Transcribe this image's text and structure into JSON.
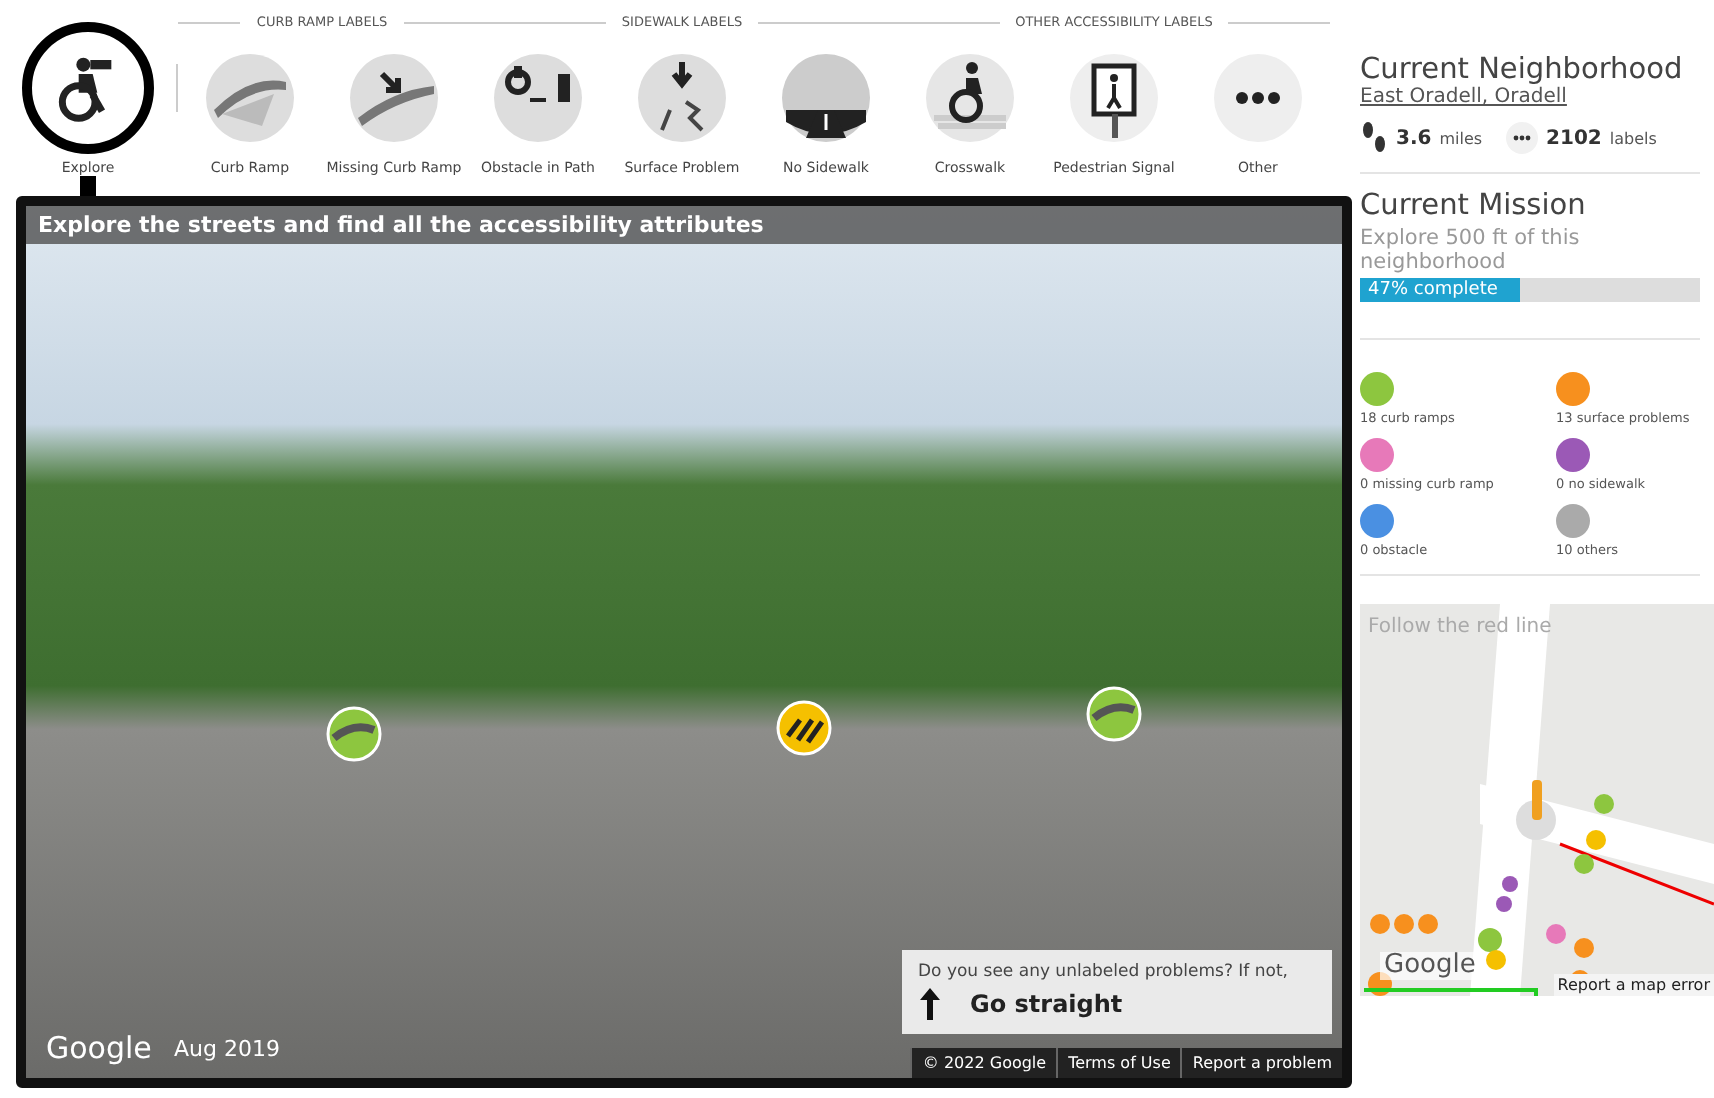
{
  "toolbar": {
    "explore": {
      "label": "Explore",
      "kind": "explore",
      "selected": true
    },
    "groups": [
      {
        "heading": "CURB RAMP LABELS",
        "tools": [
          {
            "label": "Curb Ramp",
            "kind": "curb_ramp",
            "selected": false
          },
          {
            "label": "Missing Curb Ramp",
            "kind": "missing_curb_ramp",
            "selected": false
          }
        ]
      },
      {
        "heading": "SIDEWALK LABELS",
        "tools": [
          {
            "label": "Obstacle in Path",
            "kind": "obstacle",
            "selected": false
          },
          {
            "label": "Surface Problem",
            "kind": "surface_problem",
            "selected": false
          },
          {
            "label": "No Sidewalk",
            "kind": "no_sidewalk",
            "selected": false
          }
        ]
      },
      {
        "heading": "OTHER ACCESSIBILITY LABELS",
        "tools": [
          {
            "label": "Crosswalk",
            "kind": "crosswalk",
            "selected": false
          },
          {
            "label": "Pedestrian Signal",
            "kind": "pedestrian_signal",
            "selected": false
          },
          {
            "label": "Other",
            "kind": "other",
            "selected": false
          }
        ]
      }
    ]
  },
  "street_view": {
    "title": "Explore the streets and find all the accessibility attributes",
    "google": "Google",
    "date": "Aug 2019",
    "prompt": {
      "question": "Do you see any unlabeled problems? If not,",
      "action": "Go straight"
    },
    "footer": [
      "© 2022 Google",
      "Terms of Use",
      "Report a problem"
    ]
  },
  "neighborhood": {
    "heading": "Current Neighborhood",
    "name": "East Oradell, Oradell",
    "distance": "3.6",
    "distance_unit": "miles",
    "labels": "2102",
    "labels_unit": "labels"
  },
  "mission": {
    "heading": "Current Mission",
    "description": "Explore 500 ft of this neighborhood",
    "progress": {
      "level": 0.47,
      "text": "47% complete"
    },
    "stats": [
      {
        "label": "18 curb ramps",
        "color": "#8dc63f"
      },
      {
        "label": "13 surface problems",
        "color": "#f7901e"
      },
      {
        "label": "0 missing curb ramp",
        "color": "#e779b9"
      },
      {
        "label": "0 no sidewalk",
        "color": "#9b59b6"
      },
      {
        "label": "0 obstacle",
        "color": "#4a90e2"
      },
      {
        "label": "10 others",
        "color": "#aaaaaa"
      }
    ]
  },
  "map": {
    "hint": "Follow the red line",
    "google": "Google",
    "report": "Report a map error"
  }
}
